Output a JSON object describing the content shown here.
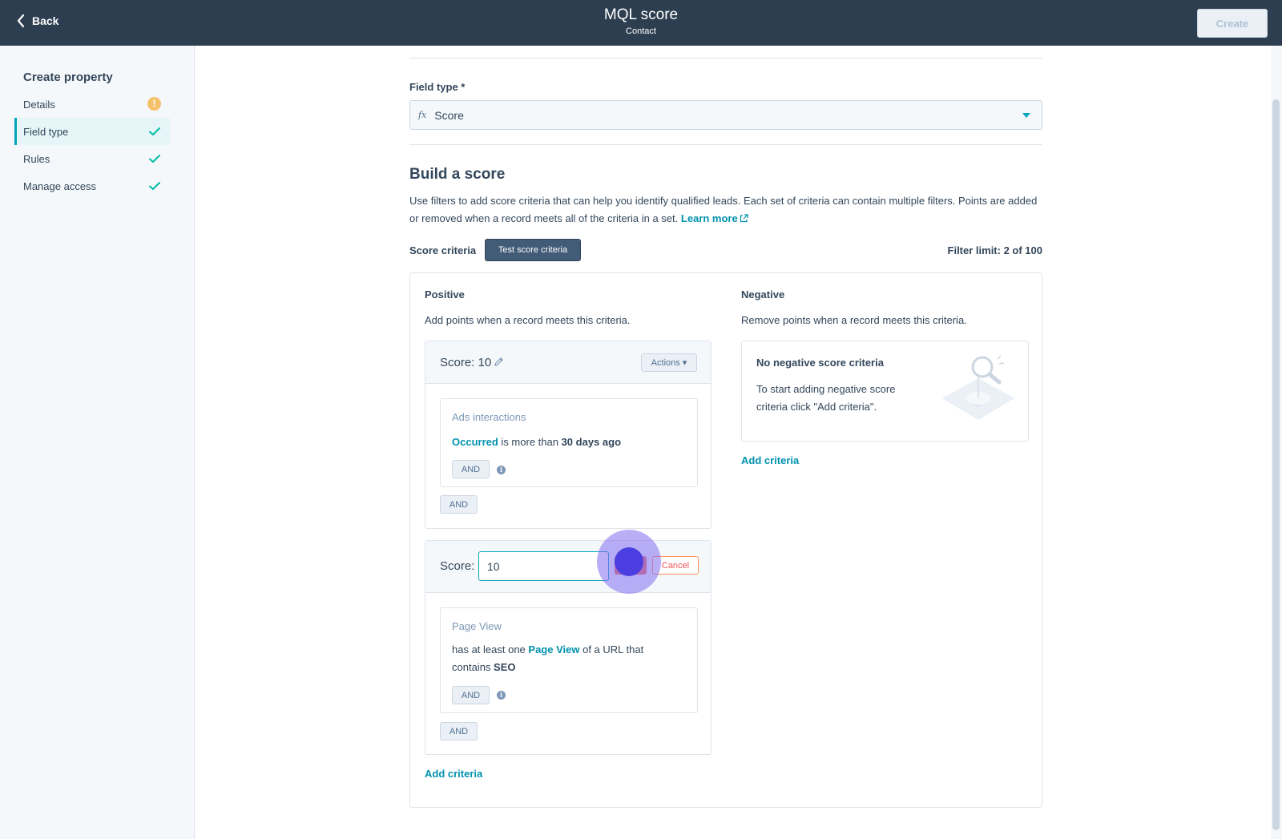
{
  "header": {
    "back_label": "Back",
    "title": "MQL score",
    "subtitle": "Contact",
    "create_label": "Create"
  },
  "sidebar": {
    "title": "Create property",
    "items": [
      {
        "label": "Details",
        "status": "warning"
      },
      {
        "label": "Field type",
        "status": "complete",
        "active": true
      },
      {
        "label": "Rules",
        "status": "complete"
      },
      {
        "label": "Manage access",
        "status": "complete"
      }
    ]
  },
  "field_type": {
    "label": "Field type *",
    "icon": "fx",
    "value": "Score"
  },
  "build": {
    "title": "Build a score",
    "description": "Use filters to add score criteria that can help you identify qualified leads. Each set of criteria can contain multiple filters. Points are added or removed when a record meets all of the criteria in a set.",
    "learn_more": "Learn more"
  },
  "criteria": {
    "label": "Score criteria",
    "test_label": "Test score criteria",
    "limit": "Filter limit: 2 of 100"
  },
  "positive": {
    "title": "Positive",
    "description": "Add points when a record meets this criteria.",
    "card1": {
      "score_label": "Score: 10",
      "actions_label": "Actions",
      "filter_title": "Ads interactions",
      "filter_link": "Occurred",
      "filter_mid": " is more than ",
      "filter_bold": "30 days ago",
      "and_inner": "AND",
      "and_outer": "AND"
    },
    "card2": {
      "score_label": "Score:",
      "input_value": "10",
      "cancel_label": "Cancel",
      "filter_title": "Page View",
      "filter_pre": "has at least one ",
      "filter_link": "Page View",
      "filter_mid": " of a URL that contains ",
      "filter_bold": "SEO",
      "and_inner": "AND",
      "and_outer": "AND"
    },
    "add_criteria": "Add criteria"
  },
  "negative": {
    "title": "Negative",
    "description": "Remove points when a record meets this criteria.",
    "empty_title": "No negative score criteria",
    "empty_text": "To start adding negative score criteria click \"Add criteria\".",
    "add_criteria": "Add criteria"
  },
  "colors": {
    "header_bg": "#2d3e50",
    "accent": "#00a4bd",
    "link": "#0091ae",
    "warning": "#f5c26b"
  }
}
